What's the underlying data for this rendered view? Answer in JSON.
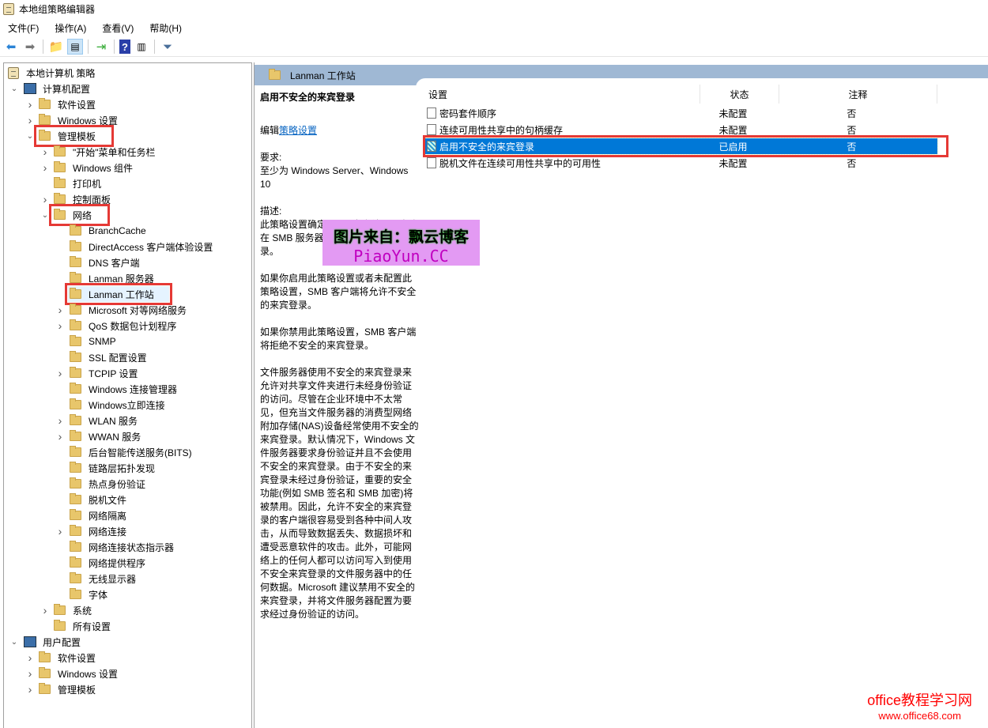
{
  "window": {
    "title": "本地组策略编辑器"
  },
  "menu": [
    "文件(F)",
    "操作(A)",
    "查看(V)",
    "帮助(H)"
  ],
  "tree": [
    {
      "label": "本地计算机 策略",
      "level": 0,
      "caret": "",
      "icon": "scroll"
    },
    {
      "label": "计算机配置",
      "level": 1,
      "caret": "open",
      "icon": "pc"
    },
    {
      "label": "软件设置",
      "level": 2,
      "caret": "closed"
    },
    {
      "label": "Windows 设置",
      "level": 2,
      "caret": "closed"
    },
    {
      "label": "管理模板",
      "level": 2,
      "caret": "open",
      "hl": true
    },
    {
      "label": "\"开始\"菜单和任务栏",
      "level": 3,
      "caret": "closed"
    },
    {
      "label": "Windows 组件",
      "level": 3,
      "caret": "closed"
    },
    {
      "label": "打印机",
      "level": 3,
      "caret": ""
    },
    {
      "label": "控制面板",
      "level": 3,
      "caret": "closed"
    },
    {
      "label": "网络",
      "level": 3,
      "caret": "open",
      "hl": true
    },
    {
      "label": "BranchCache",
      "level": 4,
      "caret": ""
    },
    {
      "label": "DirectAccess 客户端体验设置",
      "level": 4,
      "caret": ""
    },
    {
      "label": "DNS 客户端",
      "level": 4,
      "caret": ""
    },
    {
      "label": "Lanman 服务器",
      "level": 4,
      "caret": ""
    },
    {
      "label": "Lanman 工作站",
      "level": 4,
      "caret": "",
      "hl": true,
      "selected": true
    },
    {
      "label": "Microsoft 对等网络服务",
      "level": 4,
      "caret": "closed"
    },
    {
      "label": "QoS 数据包计划程序",
      "level": 4,
      "caret": "closed"
    },
    {
      "label": "SNMP",
      "level": 4,
      "caret": ""
    },
    {
      "label": "SSL 配置设置",
      "level": 4,
      "caret": ""
    },
    {
      "label": "TCPIP 设置",
      "level": 4,
      "caret": "closed"
    },
    {
      "label": "Windows 连接管理器",
      "level": 4,
      "caret": ""
    },
    {
      "label": "Windows立即连接",
      "level": 4,
      "caret": ""
    },
    {
      "label": "WLAN 服务",
      "level": 4,
      "caret": "closed"
    },
    {
      "label": "WWAN 服务",
      "level": 4,
      "caret": "closed"
    },
    {
      "label": "后台智能传送服务(BITS)",
      "level": 4,
      "caret": ""
    },
    {
      "label": "链路层拓扑发现",
      "level": 4,
      "caret": ""
    },
    {
      "label": "热点身份验证",
      "level": 4,
      "caret": ""
    },
    {
      "label": "脱机文件",
      "level": 4,
      "caret": ""
    },
    {
      "label": "网络隔离",
      "level": 4,
      "caret": ""
    },
    {
      "label": "网络连接",
      "level": 4,
      "caret": "closed"
    },
    {
      "label": "网络连接状态指示器",
      "level": 4,
      "caret": ""
    },
    {
      "label": "网络提供程序",
      "level": 4,
      "caret": ""
    },
    {
      "label": "无线显示器",
      "level": 4,
      "caret": ""
    },
    {
      "label": "字体",
      "level": 4,
      "caret": ""
    },
    {
      "label": "系统",
      "level": 3,
      "caret": "closed"
    },
    {
      "label": "所有设置",
      "level": 3,
      "caret": ""
    },
    {
      "label": "用户配置",
      "level": 1,
      "caret": "open",
      "icon": "pc"
    },
    {
      "label": "软件设置",
      "level": 2,
      "caret": "closed"
    },
    {
      "label": "Windows 设置",
      "level": 2,
      "caret": "closed"
    },
    {
      "label": "管理模板",
      "level": 2,
      "caret": "closed"
    }
  ],
  "header": {
    "title": "Lanman 工作站"
  },
  "desc": {
    "title": "启用不安全的来宾登录",
    "edit_prefix": "编辑",
    "edit_link": "策略设置",
    "req_label": "要求:",
    "req_text": "至少为 Windows Server、Windows 10",
    "desc_label": "描述:",
    "p1": "此策略设置确定 SMB 客户端是否允许在 SMB 服务器上使用不安全的来宾登录。",
    "p2": "如果你启用此策略设置或者未配置此策略设置，SMB 客户端将允许不安全的来宾登录。",
    "p3": "如果你禁用此策略设置，SMB 客户端将拒绝不安全的来宾登录。",
    "p4": "文件服务器使用不安全的来宾登录来允许对共享文件夹进行未经身份验证的访问。尽管在企业环境中不太常见，但充当文件服务器的消费型网络附加存储(NAS)设备经常使用不安全的来宾登录。默认情况下，Windows 文件服务器要求身份验证并且不会使用不安全的来宾登录。由于不安全的来宾登录未经过身份验证，重要的安全功能(例如 SMB 签名和 SMB 加密)将被禁用。因此，允许不安全的来宾登录的客户端很容易受到各种中间人攻击，从而导致数据丢失、数据损坏和遭受恶意软件的攻击。此外，可能网络上的任何人都可以访问写入到使用不安全来宾登录的文件服务器中的任何数据。Microsoft 建议禁用不安全的来宾登录，并将文件服务器配置为要求经过身份验证的访问。"
  },
  "list": {
    "columns": [
      "设置",
      "状态",
      "注释"
    ],
    "rows": [
      {
        "name": "密码套件顺序",
        "state": "未配置",
        "note": "否"
      },
      {
        "name": "连续可用性共享中的句柄缓存",
        "state": "未配置",
        "note": "否"
      },
      {
        "name": "启用不安全的来宾登录",
        "state": "已启用",
        "note": "否",
        "selected": true
      },
      {
        "name": "脱机文件在连续可用性共享中的可用性",
        "state": "未配置",
        "note": "否"
      }
    ]
  },
  "watermark": {
    "line1": "图片来自：飘云博客",
    "line2": "PiaoYun.CC"
  },
  "brand": {
    "line1": "office教程学习网",
    "line2": "www.office68.com"
  }
}
